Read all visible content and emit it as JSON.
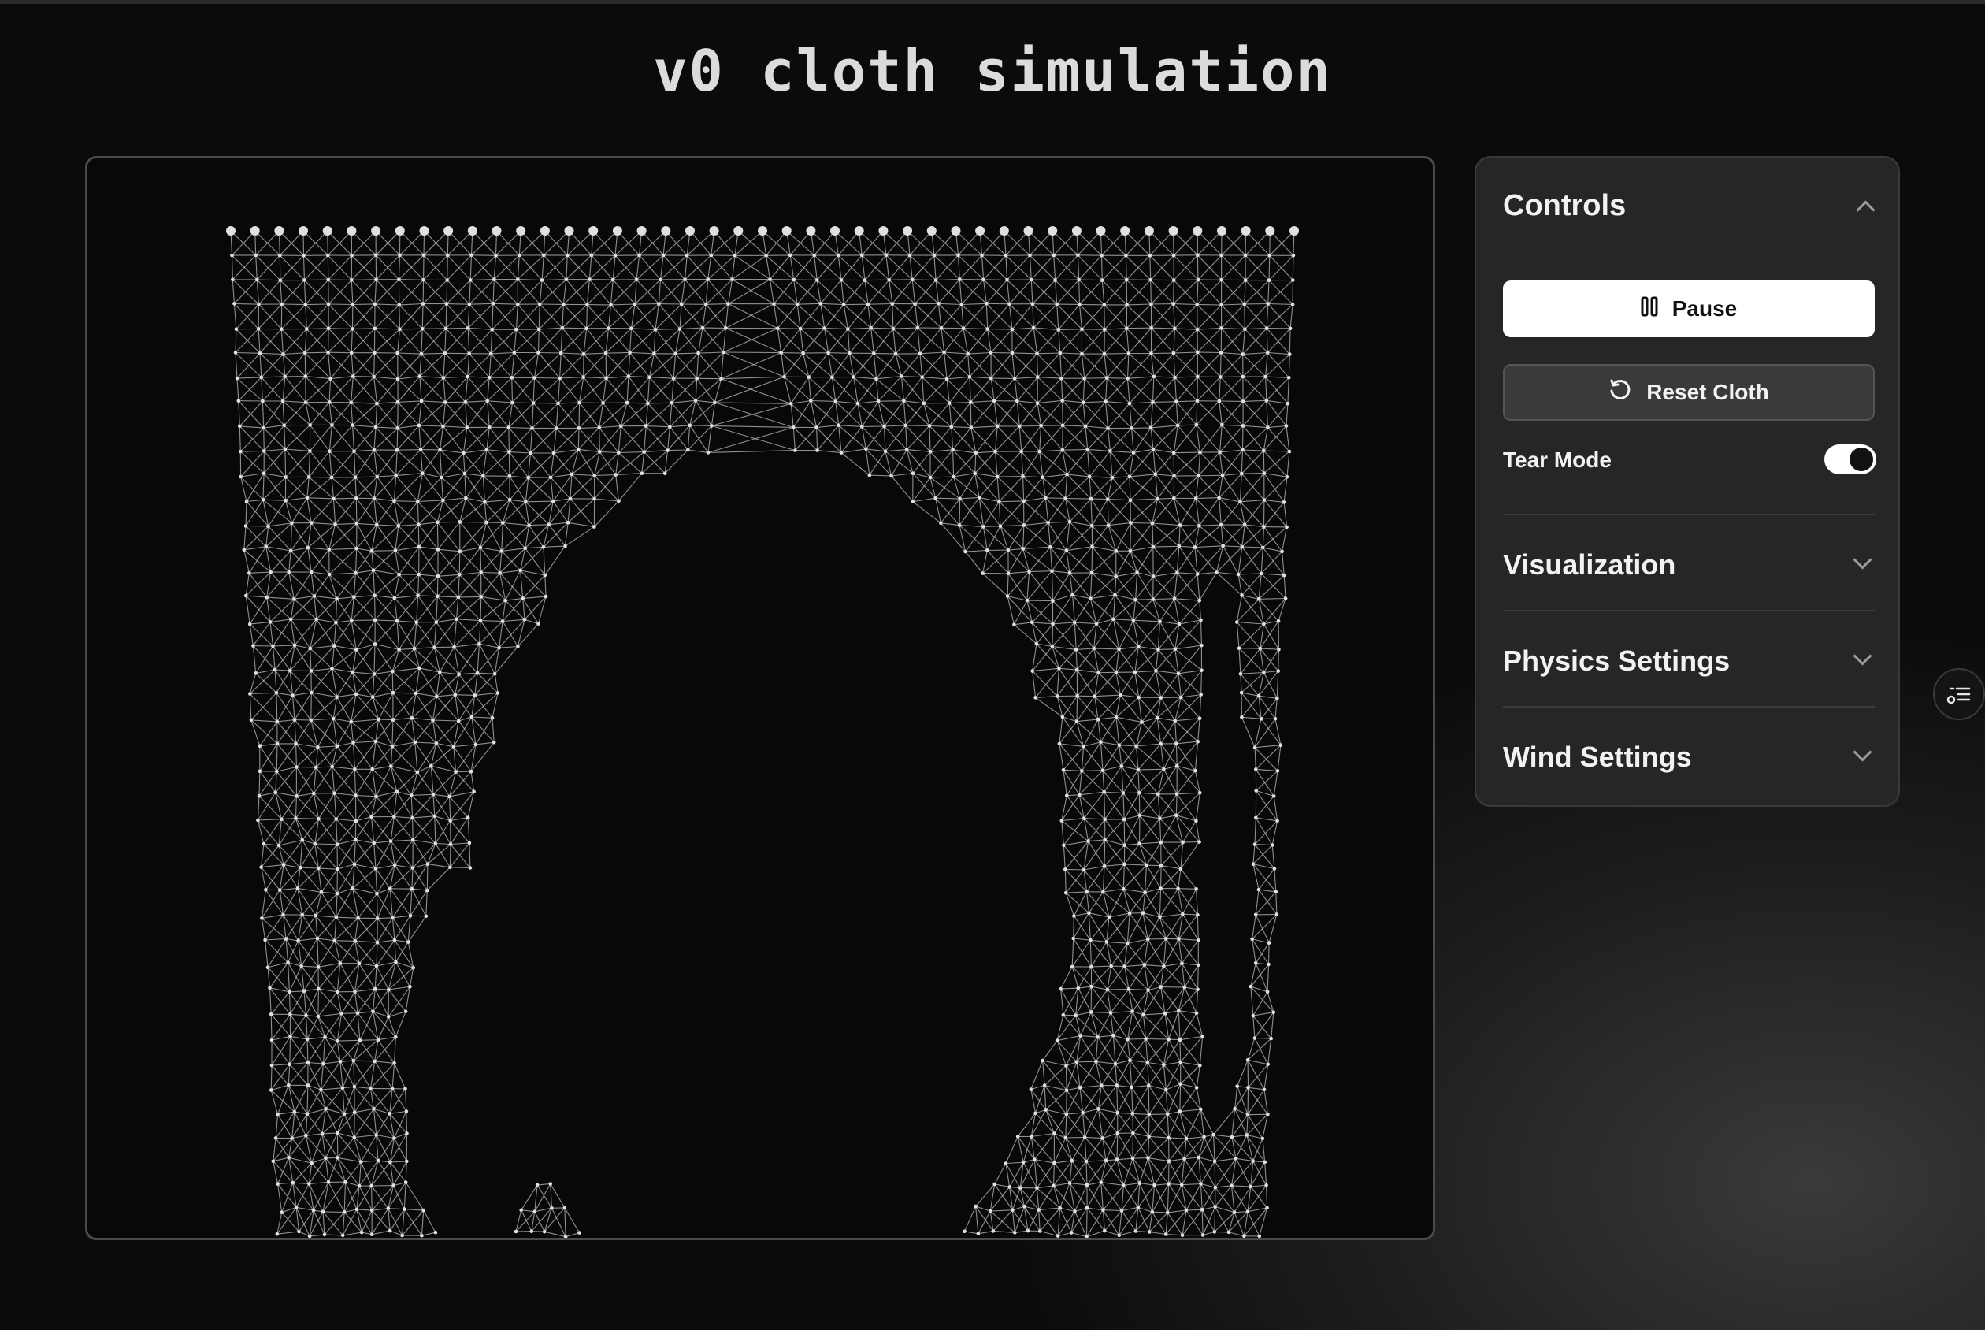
{
  "page": {
    "title": "v0 cloth simulation"
  },
  "controls": {
    "title": "Controls",
    "pause_label": "Pause",
    "reset_label": "Reset Cloth",
    "tear_mode_label": "Tear Mode",
    "tear_mode_on": true
  },
  "sections": [
    {
      "label": "Visualization"
    },
    {
      "label": "Physics Settings"
    },
    {
      "label": "Wind Settings"
    }
  ],
  "icons": {
    "pause": "pause-icon",
    "reset": "rotate-ccw-icon",
    "collapse": "chevron-up-icon",
    "expand": "chevron-down-icon",
    "floating": "settings-list-icon"
  },
  "colors": {
    "mesh": "#bdbdbd",
    "node": "#e0e0e0",
    "panel_bg": "#262626"
  }
}
